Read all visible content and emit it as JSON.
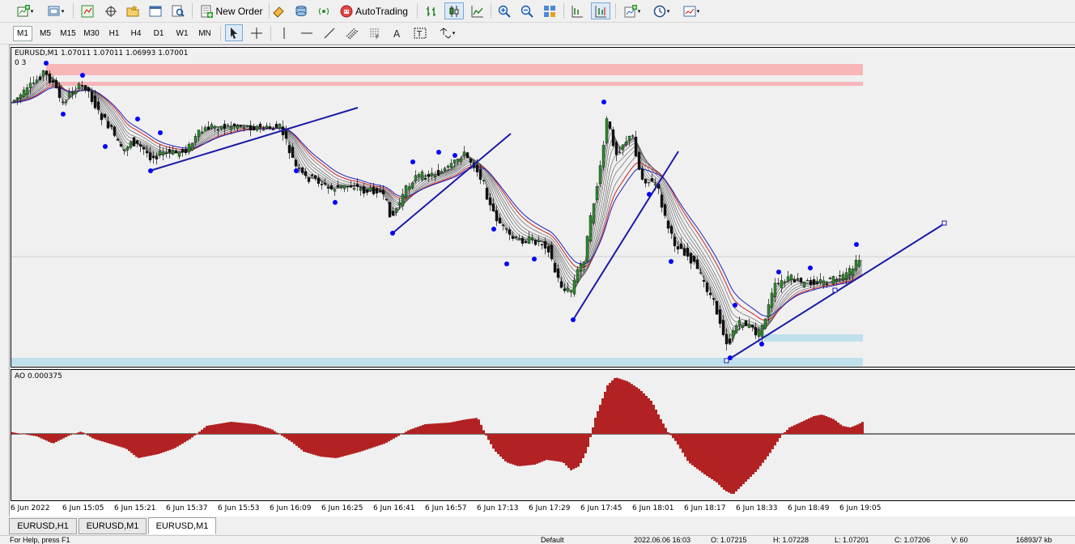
{
  "toolbar": {
    "new_order_label": "New Order",
    "autotrading_label": "AutoTrading",
    "timeframes": [
      "M1",
      "M5",
      "M15",
      "M30",
      "H1",
      "H4",
      "D1",
      "W1",
      "MN"
    ],
    "active_timeframe": "M1"
  },
  "chart": {
    "symbol_header": "EURUSD,M1  1.07011 1.07011 1.06993 1.07001",
    "sub_header": "0   3",
    "ao_label": "AO 0.000375",
    "time_labels": [
      "6 Jun 2022",
      "6 Jun 15:05",
      "6 Jun 15:21",
      "6 Jun 15:37",
      "6 Jun 15:53",
      "6 Jun 16:09",
      "6 Jun 16:25",
      "6 Jun 16:41",
      "6 Jun 16:57",
      "6 Jun 17:13",
      "6 Jun 17:29",
      "6 Jun 17:45",
      "6 Jun 18:01",
      "6 Jun 18:17",
      "6 Jun 18:33",
      "6 Jun 18:49",
      "6 Jun 19:05"
    ],
    "colors": {
      "ao_bar": "#b22222",
      "ribbon_top": "#1f1fbf",
      "ribbon_red": "#cc2222",
      "trendline": "#1a1aa8",
      "dots": "#0000ff",
      "resistance_zone": "#f7b6b8",
      "support_zone": "#bfe0ec"
    }
  },
  "tabs": [
    {
      "label": "EURUSD,H1",
      "active": false
    },
    {
      "label": "EURUSD,M1",
      "active": false
    },
    {
      "label": "EURUSD,M1",
      "active": true
    }
  ],
  "status": {
    "left": "For Help, press F1",
    "profile": "Default",
    "datetime": "2022.06.06 16:03",
    "open": "O: 1.07215",
    "high": "H: 1.07228",
    "low": "L: 1.07201",
    "close": "C: 1.07206",
    "volume": "V: 60",
    "traffic": "16893/7 kb"
  }
}
